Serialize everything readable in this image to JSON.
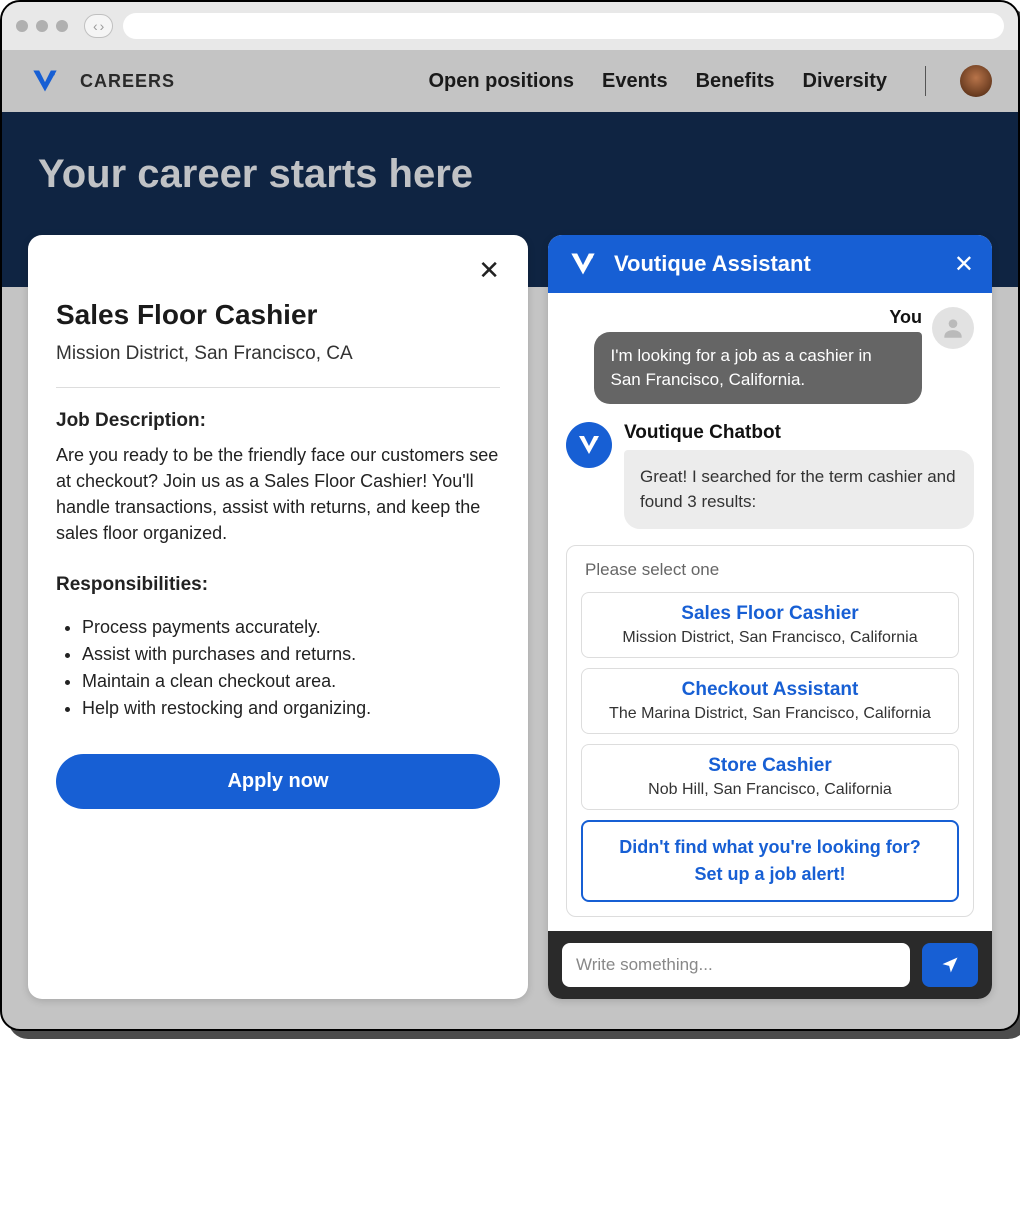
{
  "header": {
    "brand_sub": "CAREERS",
    "nav": [
      "Open positions",
      "Events",
      "Benefits",
      "Diversity"
    ]
  },
  "hero": {
    "title": "Your career starts here"
  },
  "job": {
    "title": "Sales Floor Cashier",
    "location": "Mission District, San Francisco, CA",
    "description_label": "Job Description:",
    "description": "Are you ready to be the friendly face our customers see at checkout? Join us as a Sales Floor Cashier! You'll handle transactions, assist with returns, and keep the sales floor organized.",
    "responsibilities_label": "Responsibilities:",
    "responsibilities": [
      "Process payments accurately.",
      "Assist with purchases and returns.",
      "Maintain a clean checkout area.",
      "Help with restocking and organizing."
    ],
    "apply_label": "Apply now"
  },
  "chat": {
    "title": "Voutique Assistant",
    "you_label": "You",
    "user_message": "I'm looking for a job as a cashier in San Francisco, California.",
    "bot_name": "Voutique Chatbot",
    "bot_message": "Great! I searched for the term cashier and found 3 results:",
    "select_prompt": "Please select one",
    "results": [
      {
        "title": "Sales Floor Cashier",
        "location": "Mission District, San Francisco, California"
      },
      {
        "title": "Checkout Assistant",
        "location": "The Marina District, San Francisco, California"
      },
      {
        "title": "Store Cashier",
        "location": "Nob Hill, San Francisco, California"
      }
    ],
    "alert_line1": "Didn't find what you're looking for?",
    "alert_line2": "Set up a job alert!",
    "input_placeholder": "Write something..."
  },
  "colors": {
    "primary": "#175fd4",
    "hero_bg": "#0f2442"
  }
}
